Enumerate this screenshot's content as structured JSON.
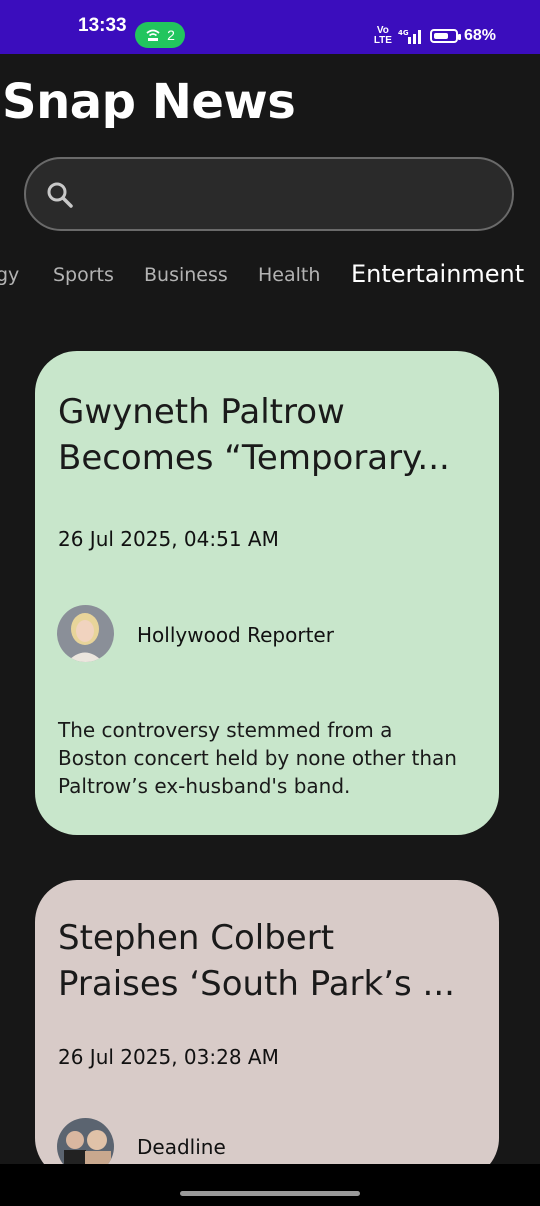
{
  "status_bar": {
    "time": "13:33",
    "hotspot_count": "2",
    "network_label": "Vo LTE",
    "signal_label": "4G",
    "battery_percent": "68%",
    "battery_level": 0.68
  },
  "app": {
    "title": "Snap News"
  },
  "search": {
    "placeholder": "",
    "value": ""
  },
  "categories": {
    "items": [
      "gy",
      "Sports",
      "Business",
      "Health",
      "Entertainment"
    ],
    "selected": "Entertainment"
  },
  "articles": [
    {
      "headline_line1": "Gwyneth Paltrow",
      "headline_line2": "Becomes “Temporary...",
      "date": "26 Jul 2025, 04:51 AM",
      "source": "Hollywood Reporter",
      "description_line1": "The controversy stemmed from a",
      "description_line2": "Boston concert held by none other than",
      "description_line3": "Paltrow’s ex-husband's band.",
      "card_color": "#c8e6cb"
    },
    {
      "headline_line1": "Stephen Colbert",
      "headline_line2": "Praises ‘South Park’s ...",
      "date": "26 Jul 2025, 03:28 AM",
      "source": "Deadline",
      "card_color": "#d8cbc8"
    }
  ],
  "colors": {
    "status_bar": "#3b0dbd",
    "background": "#171717",
    "hotspot": "#22c55e"
  }
}
